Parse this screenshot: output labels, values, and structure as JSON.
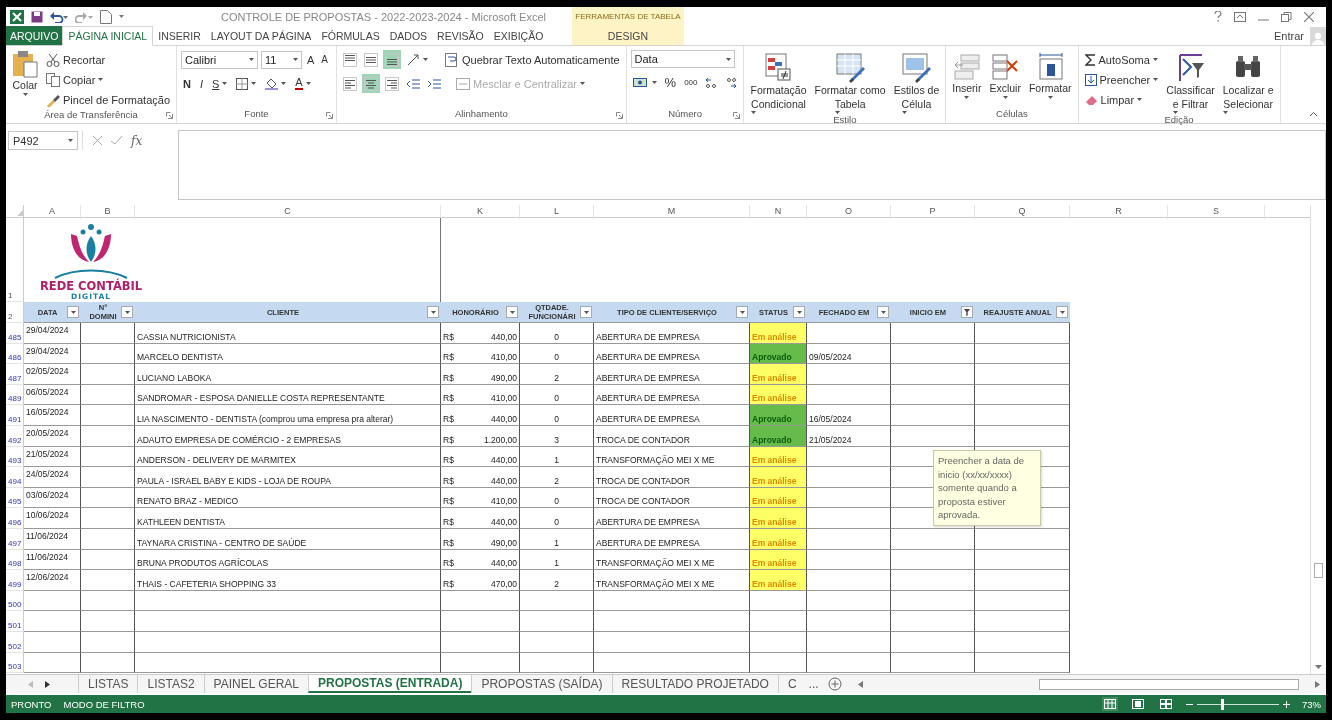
{
  "window": {
    "title": "CONTROLE DE PROPOSTAS - 2022-2023-2024 - Microsoft Excel",
    "context_group": "FERRAMENTAS DE TABELA",
    "sign_in": "Entrar"
  },
  "ribbon_tabs": [
    {
      "label": "ARQUIVO",
      "kind": "file",
      "selected": false
    },
    {
      "label": "PÁGINA INICIAL",
      "kind": "tab",
      "selected": true
    },
    {
      "label": "INSERIR",
      "kind": "tab",
      "selected": false
    },
    {
      "label": "LAYOUT DA PÁGINA",
      "kind": "tab",
      "selected": false
    },
    {
      "label": "FÓRMULAS",
      "kind": "tab",
      "selected": false
    },
    {
      "label": "DADOS",
      "kind": "tab",
      "selected": false
    },
    {
      "label": "REVISÃO",
      "kind": "tab",
      "selected": false
    },
    {
      "label": "EXIBIÇÃO",
      "kind": "tab",
      "selected": false
    },
    {
      "label": "DESIGN",
      "kind": "contextual",
      "selected": false
    }
  ],
  "ribbon": {
    "clipboard": {
      "title": "Área de Transferência",
      "paste": "Colar",
      "cut": "Recortar",
      "copy": "Copiar",
      "format_painter": "Pincel de Formatação"
    },
    "font": {
      "title": "Fonte",
      "font_name": "Calibri",
      "font_size": "11",
      "grow_font": "A",
      "shrink_font": "A",
      "bold": "N",
      "italic": "I",
      "underline": "S",
      "font_color": "A"
    },
    "alignment": {
      "title": "Alinhamento",
      "vertical": [
        {
          "selected": false
        },
        {
          "selected": false
        },
        {
          "selected": true
        }
      ],
      "horizontal": [
        {
          "selected": false
        },
        {
          "selected": true
        },
        {
          "selected": false
        }
      ],
      "wrap_text": "Quebrar Texto Automaticamente",
      "merge": {
        "label": "Mesclar e Centralizar",
        "disabled": true
      }
    },
    "number": {
      "title": "Número",
      "format": "Data",
      "percent": "%",
      "thousands": "000"
    },
    "styles": {
      "title": "Estilo",
      "buttons": [
        {
          "lines": [
            "Formatação",
            "Condicional"
          ]
        },
        {
          "lines": [
            "Formatar como",
            "Tabela"
          ]
        },
        {
          "lines": [
            "Estilos de",
            "Célula"
          ]
        }
      ]
    },
    "cells": {
      "title": "Células",
      "buttons": [
        "Inserir",
        "Excluir",
        "Formatar"
      ]
    },
    "editing": {
      "title": "Edição",
      "autosum": "AutoSoma",
      "fill": "Preencher",
      "clear": "Limpar",
      "buttons": [
        {
          "lines": [
            "Classificar",
            "e Filtrar"
          ]
        },
        {
          "lines": [
            "Localizar e",
            "Selecionar"
          ]
        }
      ]
    }
  },
  "formula_bar": {
    "name_box": "P492",
    "function_button": "fx"
  },
  "sheet": {
    "column_headers": [
      "A",
      "B",
      "C",
      "K",
      "L",
      "M",
      "N",
      "O",
      "P",
      "Q",
      "R",
      "S"
    ],
    "header_rows": [
      "1",
      "2"
    ],
    "logo": {
      "name": "REDE CONTÁBIL",
      "tagline": "DIGITAL"
    },
    "table_columns": [
      {
        "lines": [
          "DATA"
        ],
        "filtered": false
      },
      {
        "lines": [
          "N°",
          "DOMINI"
        ],
        "filtered": false
      },
      {
        "lines": [
          "CLIENTE"
        ],
        "filtered": false
      },
      {
        "lines": [
          "HONORÁRIO"
        ],
        "filtered": false
      },
      {
        "lines": [
          "QTDADE.",
          "FUNCIONÁRI"
        ],
        "filtered": false
      },
      {
        "lines": [
          "TIPO DE CLIENTE/SERVIÇO"
        ],
        "filtered": false
      },
      {
        "lines": [
          "STATUS"
        ],
        "filtered": false
      },
      {
        "lines": [
          "FECHADO EM"
        ],
        "filtered": false
      },
      {
        "lines": [
          "INICIO EM"
        ],
        "filtered": true
      },
      {
        "lines": [
          "REAJUSTE ANUAL"
        ],
        "filtered": false
      }
    ],
    "rows": [
      {
        "row": "485",
        "date": "29/04/2024",
        "client": "CASSIA NUTRICIONISTA",
        "currency": "R$",
        "fee": "440,00",
        "employees": "0",
        "service": "ABERTURA DE EMPRESA",
        "status": "Em análise",
        "kind": "pending"
      },
      {
        "row": "486",
        "date": "29/04/2024",
        "client": "MARCELO DENTISTA",
        "currency": "R$",
        "fee": "410,00",
        "employees": "0",
        "service": "ABERTURA DE EMPRESA",
        "status": "Aprovado",
        "kind": "approved",
        "closed": "09/05/2024"
      },
      {
        "row": "487",
        "date": "02/05/2024",
        "client": "LUCIANO LABOKA",
        "currency": "R$",
        "fee": "490,00",
        "employees": "2",
        "service": "ABERTURA DE EMPRESA",
        "status": "Em análise",
        "kind": "pending"
      },
      {
        "row": "489",
        "date": "06/05/2024",
        "client": "SANDROMAR - ESPOSA DANIELLE COSTA REPRESENTANTE",
        "currency": "R$",
        "fee": "410,00",
        "employees": "0",
        "service": "ABERTURA DE EMPRESA",
        "status": "Em análise",
        "kind": "pending"
      },
      {
        "row": "491",
        "date": "16/05/2024",
        "client": "LIA NASCIMENTO - DENTISTA (comprou uma empresa pra alterar)",
        "currency": "R$",
        "fee": "440,00",
        "employees": "0",
        "service": "ABERTURA DE EMPRESA",
        "status": "Aprovado",
        "kind": "approved",
        "closed": "16/05/2024"
      },
      {
        "row": "492",
        "date": "20/05/2024",
        "client": "ADAUTO EMPRESA DE COMÉRCIO - 2 EMPRESAS",
        "currency": "R$",
        "fee": "1.200,00",
        "employees": "3",
        "service": "TROCA DE CONTADOR",
        "status": "Aprovado",
        "kind": "approved",
        "closed": "21/05/2024"
      },
      {
        "row": "493",
        "date": "21/05/2024",
        "client": "ANDERSON - DELIVERY DE MARMITEX",
        "currency": "R$",
        "fee": "440,00",
        "employees": "1",
        "service": "TRANSFORMAÇÃO MEI X ME",
        "status": "Em análise",
        "kind": "pending"
      },
      {
        "row": "494",
        "date": "24/05/2024",
        "client": "PAULA - ISRAEL BABY E KIDS - LOJA DE ROUPA",
        "currency": "R$",
        "fee": "440,00",
        "employees": "2",
        "service": "TROCA DE CONTADOR",
        "status": "Em análise",
        "kind": "pending"
      },
      {
        "row": "495",
        "date": "03/06/2024",
        "client": "RENATO BRAZ - MEDICO",
        "currency": "R$",
        "fee": "410,00",
        "employees": "0",
        "service": "TROCA DE CONTADOR",
        "status": "Em análise",
        "kind": "pending"
      },
      {
        "row": "496",
        "date": "10/06/2024",
        "client": "KATHLEEN DENTISTA",
        "currency": "R$",
        "fee": "440,00",
        "employees": "0",
        "service": "ABERTURA DE EMPRESA",
        "status": "Em análise",
        "kind": "pending"
      },
      {
        "row": "497",
        "date": "11/06/2024",
        "client": "TAYNARA CRISTINA - CENTRO DE SAÚDE",
        "currency": "R$",
        "fee": "490,00",
        "employees": "1",
        "service": "ABERTURA DE EMPRESA",
        "status": "Em análise",
        "kind": "pending"
      },
      {
        "row": "498",
        "date": "11/06/2024",
        "client": "BRUNA PRODUTOS AGRÍCOLAS",
        "currency": "R$",
        "fee": "440,00",
        "employees": "1",
        "service": "TRANSFORMAÇÃO MEI X ME",
        "status": "Em análise",
        "kind": "pending"
      },
      {
        "row": "499",
        "date": "12/06/2024",
        "client": "THAIS - CAFETERIA SHOPPING 33",
        "currency": "R$",
        "fee": "470,00",
        "employees": "2",
        "service": "TRANSFORMAÇÃO MEI X ME",
        "status": "Em análise",
        "kind": "pending"
      }
    ],
    "empty_rows": [
      "500",
      "501",
      "502",
      "503"
    ],
    "comment": "Preencher a data de inicio (xx/xx/xxxx) somente quando a proposta estiver aprovada."
  },
  "sheet_tabs": [
    {
      "label": "LISTAS",
      "selected": false
    },
    {
      "label": "LISTAS2",
      "selected": false
    },
    {
      "label": "PAINEL GERAL",
      "selected": false
    },
    {
      "label": "PROPOSTAS (ENTRADA)",
      "selected": true
    },
    {
      "label": "PROPOSTAS (SAÍDA)",
      "selected": false
    },
    {
      "label": "RESULTADO PROJETADO",
      "selected": false
    },
    {
      "label": "C",
      "selected": false
    }
  ],
  "more_tabs": "...",
  "status_bar": {
    "ready": "PRONTO",
    "mode": "MODO DE FILTRO",
    "views": [
      {
        "selected": true
      },
      {
        "selected": false
      },
      {
        "selected": false
      }
    ],
    "level": 0.29,
    "zoom": "73%"
  }
}
